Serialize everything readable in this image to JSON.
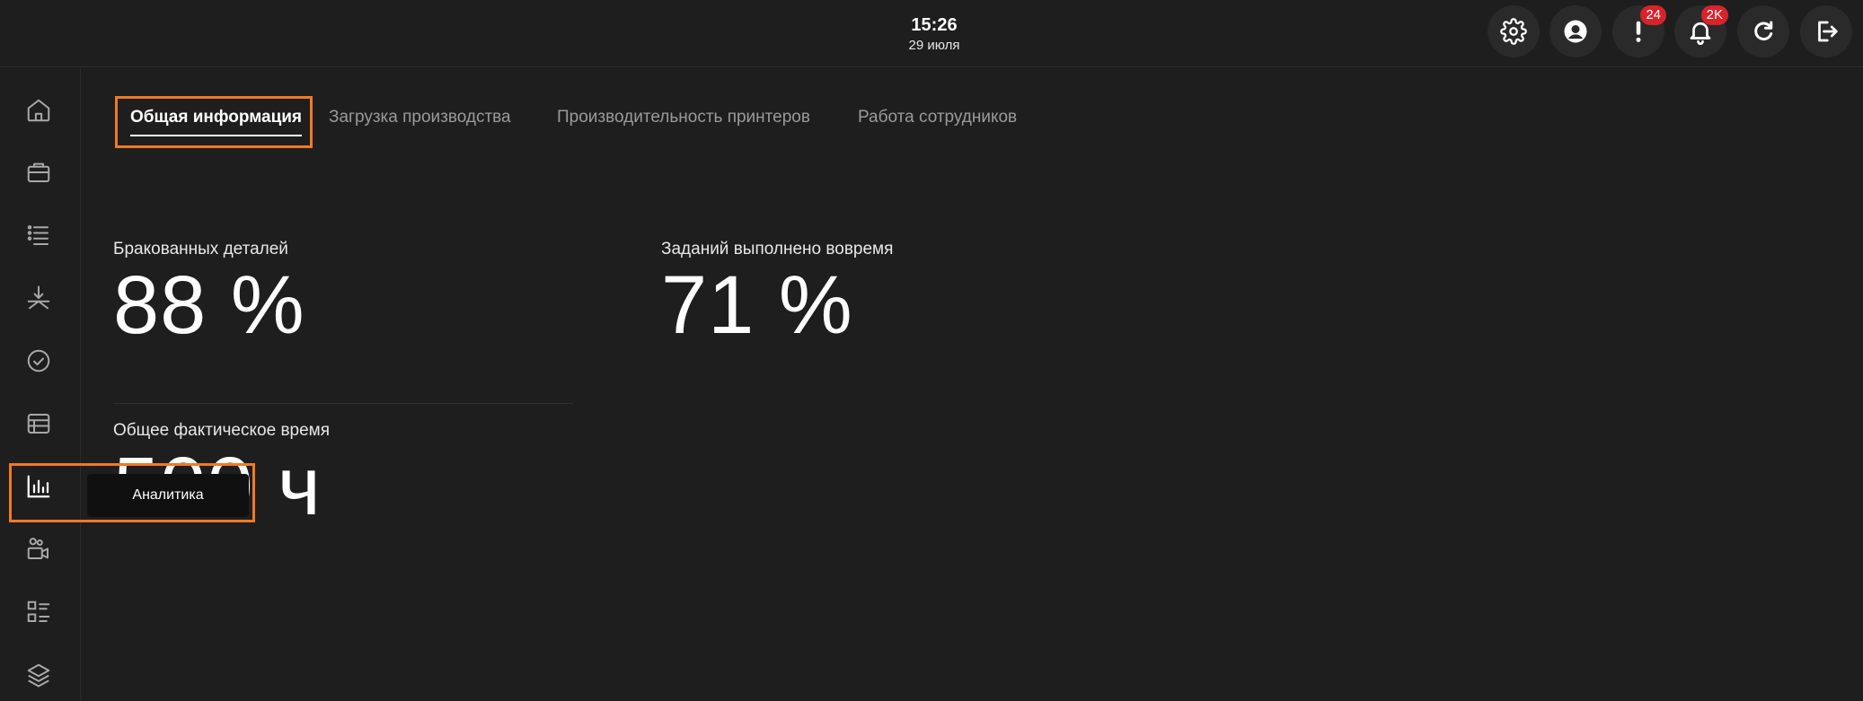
{
  "header": {
    "time": "15:26",
    "date": "29 июля",
    "buttons": [
      {
        "icon": "gear-icon"
      },
      {
        "icon": "user-icon"
      },
      {
        "icon": "alert-icon",
        "badge": "24"
      },
      {
        "icon": "bell-icon",
        "badge": "2K"
      },
      {
        "icon": "refresh-icon"
      },
      {
        "icon": "logout-icon"
      }
    ]
  },
  "sidebar": {
    "items": [
      {
        "icon": "home-icon"
      },
      {
        "icon": "briefcase-icon"
      },
      {
        "icon": "list-icon"
      },
      {
        "icon": "merge-icon"
      },
      {
        "icon": "check-circle-icon"
      },
      {
        "icon": "table-icon"
      },
      {
        "icon": "bar-chart-icon",
        "active": true,
        "tooltip": "Аналитика"
      },
      {
        "icon": "users-camera-icon"
      },
      {
        "icon": "checklist-icon"
      },
      {
        "icon": "layers-icon"
      }
    ]
  },
  "tabs": [
    {
      "label": "Общая информация",
      "active": true
    },
    {
      "label": "Загрузка производства"
    },
    {
      "label": "Производительность принтеров"
    },
    {
      "label": "Работа сотрудников"
    }
  ],
  "stats": {
    "defective": {
      "label": "Бракованных деталей",
      "value": "88 %"
    },
    "on_time": {
      "label": "Заданий выполнено вовремя",
      "value": "71 %"
    },
    "total_time": {
      "label": "Общее фактическое время",
      "value": "500 ч"
    }
  },
  "colors": {
    "background": "#1e1e1e",
    "highlight": "#f07a24",
    "badge": "#d8232a"
  }
}
